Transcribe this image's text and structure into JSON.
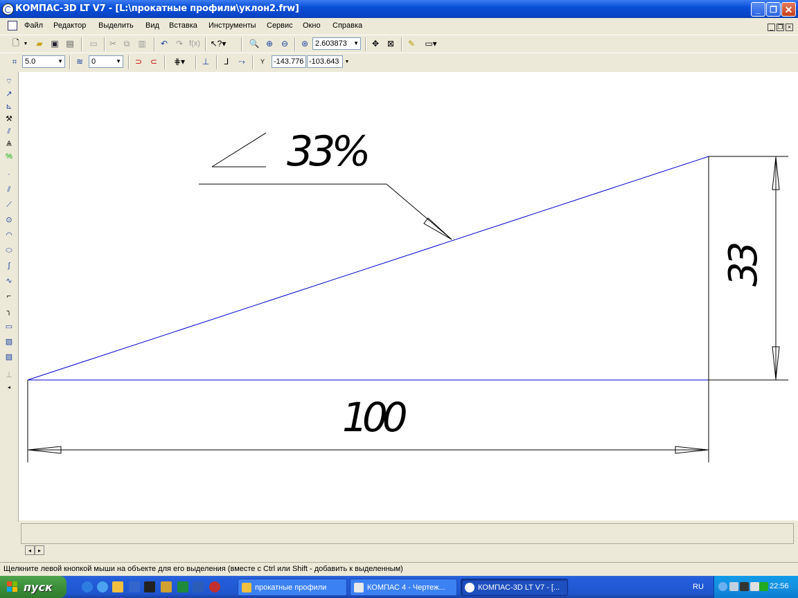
{
  "window": {
    "title": "КОМПАС-3D LT V7 - [L:\\прокатные профили\\уклон2.frw]",
    "min_label": "_",
    "max_label": "❐",
    "close_label": "✕"
  },
  "menu": {
    "items": [
      "Файл",
      "Редактор",
      "Выделить",
      "Вид",
      "Вставка",
      "Инструменты",
      "Сервис",
      "Окно",
      "Справка"
    ],
    "mdi_min": "_",
    "mdi_restore": "❐",
    "mdi_close": "×"
  },
  "toolbar1": {
    "zoom_value": "2.603873",
    "fx_label": "f(x)"
  },
  "toolbar2": {
    "step_value": "5.0",
    "layer_value": "0",
    "coord_x": "-143.776",
    "coord_y": "-103.643",
    "coord_label": "Y"
  },
  "drawing": {
    "slope_label": "33%",
    "horizontal_dim": "100",
    "vertical_dim": "33",
    "colors": {
      "geometry": "#0000cc",
      "dimension": "#000000"
    }
  },
  "statusbar": {
    "message": "Щелкните левой кнопкой мыши на объекте для его выделения (вместе с Ctrl или Shift - добавить к выделенным)"
  },
  "taskbar": {
    "start_label": "пуск",
    "tasks": [
      "прокатные профили",
      "КОМПАС 4 - Чертеж...",
      "КОМПАС-3D LT V7 - [..."
    ],
    "lang": "RU",
    "clock": "22:56"
  }
}
